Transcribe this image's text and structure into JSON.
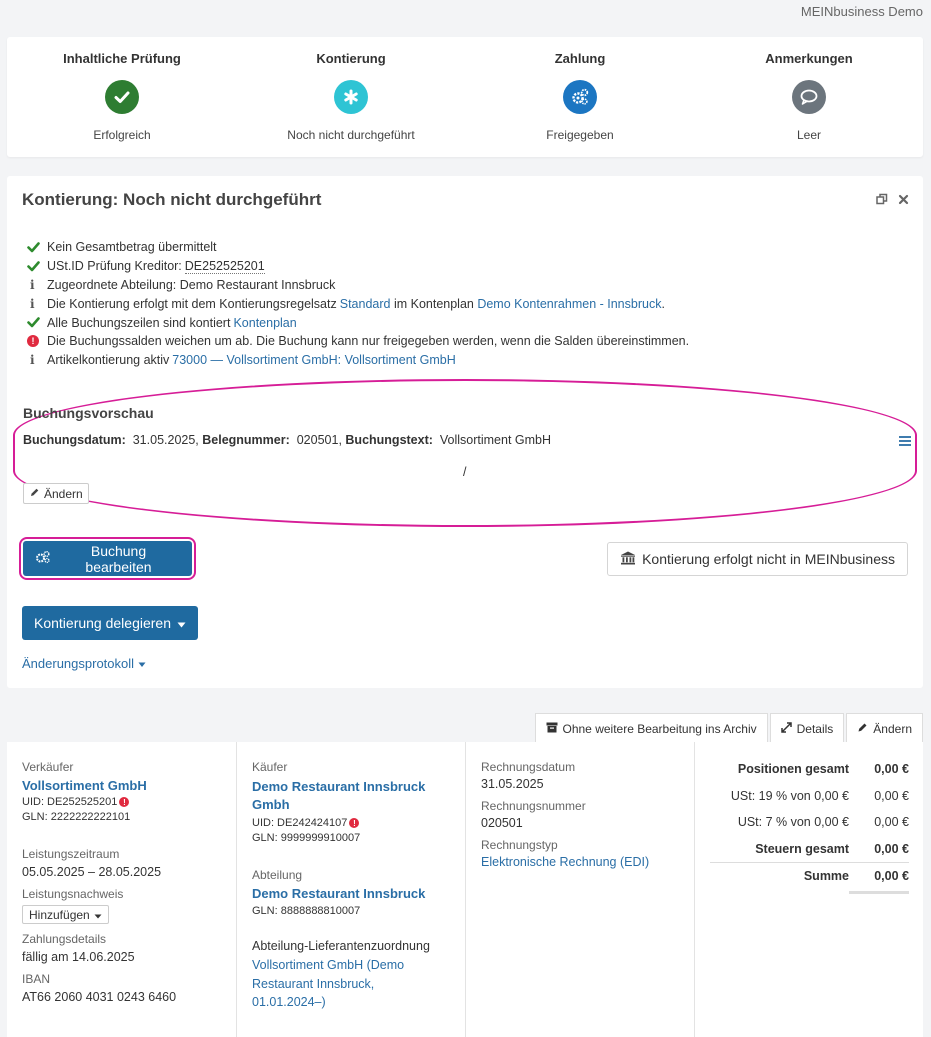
{
  "app": {
    "org": "MEINbusiness Demo"
  },
  "steps": [
    {
      "title": "Inhaltliche Prüfung",
      "status": "Erfolgreich",
      "icon": "check-icon",
      "color": "#2e7d32"
    },
    {
      "title": "Kontierung",
      "status": "Noch nicht durchgeführt",
      "icon": "asterisk-icon",
      "color": "#2ec4d4"
    },
    {
      "title": "Zahlung",
      "status": "Freigegeben",
      "icon": "gears-icon",
      "color": "#1c76c2"
    },
    {
      "title": "Anmerkungen",
      "status": "Leer",
      "icon": "comment-icon",
      "color": "#6c757d"
    }
  ],
  "kontierung": {
    "title": "Kontierung: Noch nicht durchgeführt",
    "checks": [
      {
        "type": "ok",
        "text": "Kein Gesamtbetrag übermittelt"
      },
      {
        "type": "ok",
        "text": "USt.ID Prüfung Kreditor: ",
        "value": "DE252525201"
      },
      {
        "type": "info",
        "text": "Zugeordnete Abteilung: Demo Restaurant Innsbruck"
      },
      {
        "type": "info",
        "text": "Die Kontierung erfolgt mit dem Kontierungsregelsatz ",
        "link1": "Standard",
        "mid": " im Kontenplan ",
        "link2": "Demo Kontenrahmen - Innsbruck",
        "end": "."
      },
      {
        "type": "ok",
        "text": "Alle Buchungszeilen sind kontiert ",
        "link1": "Kontenplan"
      },
      {
        "type": "error",
        "text": "Die Buchungssalden weichen um ab. Die Buchung kann nur freigegeben werden, wenn die Salden übereinstimmen."
      },
      {
        "type": "info",
        "text": "Artikelkontierung aktiv ",
        "link1": "73000 — Vollsortiment GmbH: Vollsortiment GmbH"
      }
    ],
    "preview": {
      "title": "Buchungsvorschau",
      "datum_label": "Buchungsdatum:",
      "datum": "31.05.2025",
      "beleg_label": "Belegnummer:",
      "beleg": "020501",
      "text_label": "Buchungstext:",
      "text": "Vollsortiment GmbH",
      "slash": "/",
      "edit_label": "Ändern"
    },
    "buttons": {
      "bearbeiten": "Buchung bearbeiten",
      "nicht_mein": "Kontierung erfolgt nicht in MEINbusiness",
      "delegieren": "Kontierung delegieren",
      "protokoll": "Änderungsprotokoll"
    }
  },
  "tabs": [
    {
      "label": "Ohne weitere Bearbeitung ins Archiv",
      "icon": "archive-icon"
    },
    {
      "label": "Details",
      "icon": "expand-icon"
    },
    {
      "label": "Ändern",
      "icon": "pencil-icon"
    }
  ],
  "invoice": {
    "seller": {
      "label": "Verkäufer",
      "name": "Vollsortiment GmbH",
      "uid": "UID: DE252525201",
      "gln": "GLN: 2222222222101",
      "zeitraum_label": "Leistungszeitraum",
      "zeitraum": "05.05.2025 – 28.05.2025",
      "nachweis_label": "Leistungsnachweis",
      "nachweis_btn": "Hinzufügen",
      "zahlung_label": "Zahlungsdetails",
      "zahlung": "fällig am 14.06.2025",
      "iban_label": "IBAN",
      "iban": "AT66 2060 4031 0243 6460"
    },
    "buyer": {
      "label": "Käufer",
      "name": "Demo Restaurant Innsbruck Gmbh",
      "uid": "UID: DE242424107",
      "gln": "GLN: 9999999910007",
      "abt_label": "Abteilung",
      "abt": "Demo Restaurant Innsbruck",
      "abt_gln": "GLN: 8888888810007",
      "zuord_label": "Abteilung-Lieferantenzuordnung",
      "zuord": "Vollsortiment GmbH (Demo Restaurant Innsbruck, 01.01.2024–)"
    },
    "meta": {
      "datum_label": "Rechnungsdatum",
      "datum": "31.05.2025",
      "nr_label": "Rechnungsnummer",
      "nr": "020501",
      "typ_label": "Rechnungstyp",
      "typ": "Elektronische Rechnung (EDI)"
    },
    "totals": [
      {
        "k": "Positionen gesamt",
        "v": "0,00 €",
        "bold": true
      },
      {
        "k": "USt: 19 % von 0,00 €",
        "v": "0,00 €",
        "bold": false
      },
      {
        "k": "USt: 7 % von 0,00 €",
        "v": "0,00 €",
        "bold": false
      },
      {
        "k": "Steuern gesamt",
        "v": "0,00 €",
        "bold": true
      },
      {
        "k": "Summe",
        "v": "0,00 €",
        "bold": true
      }
    ]
  }
}
